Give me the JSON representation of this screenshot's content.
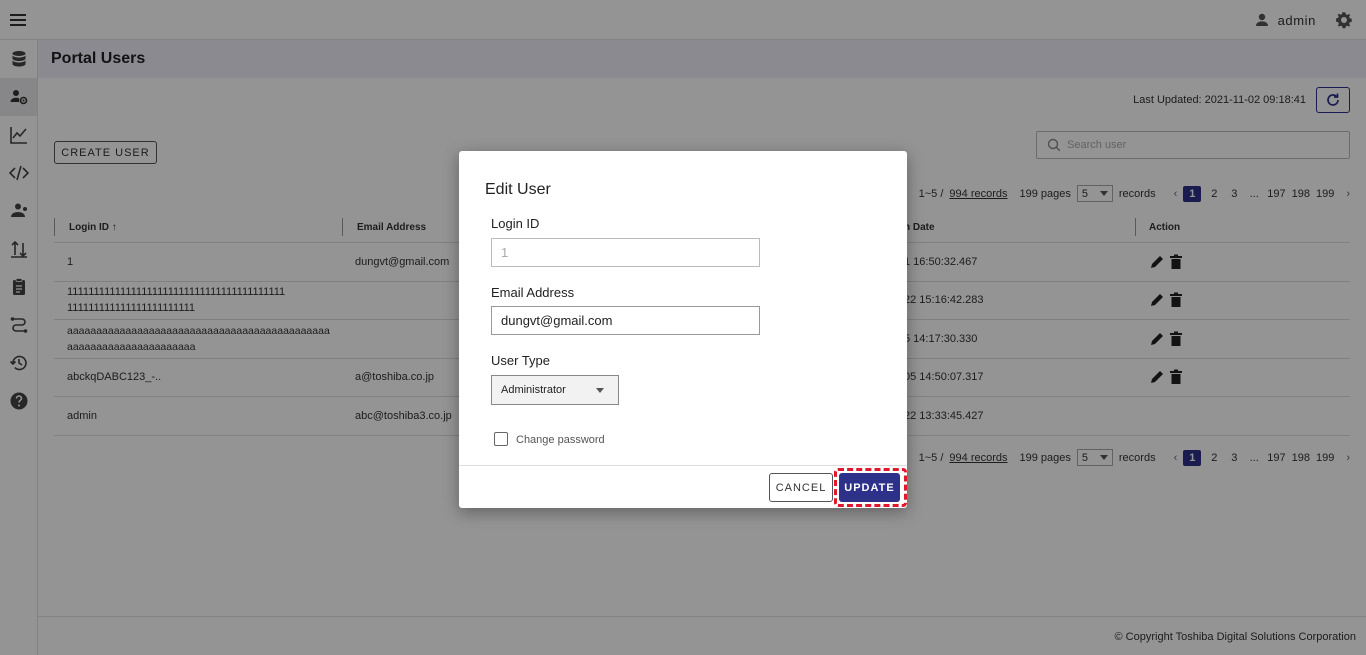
{
  "topbar": {
    "username": "admin"
  },
  "page": {
    "title": "Portal Users",
    "last_updated": "Last Updated: 2021-11-02 09:18:41",
    "create_label": "CREATE USER",
    "search_placeholder": "Search user"
  },
  "pagination": {
    "range": "1~5 /",
    "records": "994 records",
    "pages": "199 pages",
    "page_size": "5",
    "records_suffix": "records",
    "pages_list": [
      "1",
      "2",
      "3",
      "...",
      "197",
      "198",
      "199"
    ]
  },
  "table": {
    "headers": {
      "login_id": "Login ID",
      "email": "Email Address",
      "login_date": "Login Date",
      "action": "Action"
    },
    "visible_headers": {
      "login_date": "n Date"
    },
    "rows": [
      {
        "login_id": "1",
        "email": "dungvt@gmail.com",
        "date": "1 16:50:32.467",
        "actions": true
      },
      {
        "login_id": "11111111111111111111111111111111111111111\n111111111111111111111111",
        "email": "",
        "date": "22 15:16:42.283",
        "actions": true
      },
      {
        "login_id": "aaaaaaaaaaaaaaaaaaaaaaaaaaaaaaaaaaaaaaaaaaaaa\naaaaaaaaaaaaaaaaaaaaaa",
        "email": "",
        "date": "5 14:17:30.330",
        "actions": true
      },
      {
        "login_id": "abckqDABC123_-..",
        "email": "a@toshiba.co.jp",
        "date": "05 14:50:07.317",
        "actions": true
      },
      {
        "login_id": "admin",
        "email": "abc@toshiba3.co.jp",
        "date": "22 13:33:45.427",
        "actions": false
      }
    ]
  },
  "footer": {
    "copyright": "© Copyright Toshiba Digital Solutions Corporation"
  },
  "dialog": {
    "title": "Edit User",
    "login_id_label": "Login ID",
    "login_id_value": "1",
    "email_label": "Email Address",
    "email_value": "dungvt@gmail.com",
    "user_type_label": "User Type",
    "user_type_value": "Administrator",
    "change_password_label": "Change password",
    "cancel_label": "CANCEL",
    "update_label": "UPDATE"
  },
  "colors": {
    "primary": "#2d3189",
    "highlight": "#e0182d",
    "header_band": "#efeef9"
  }
}
